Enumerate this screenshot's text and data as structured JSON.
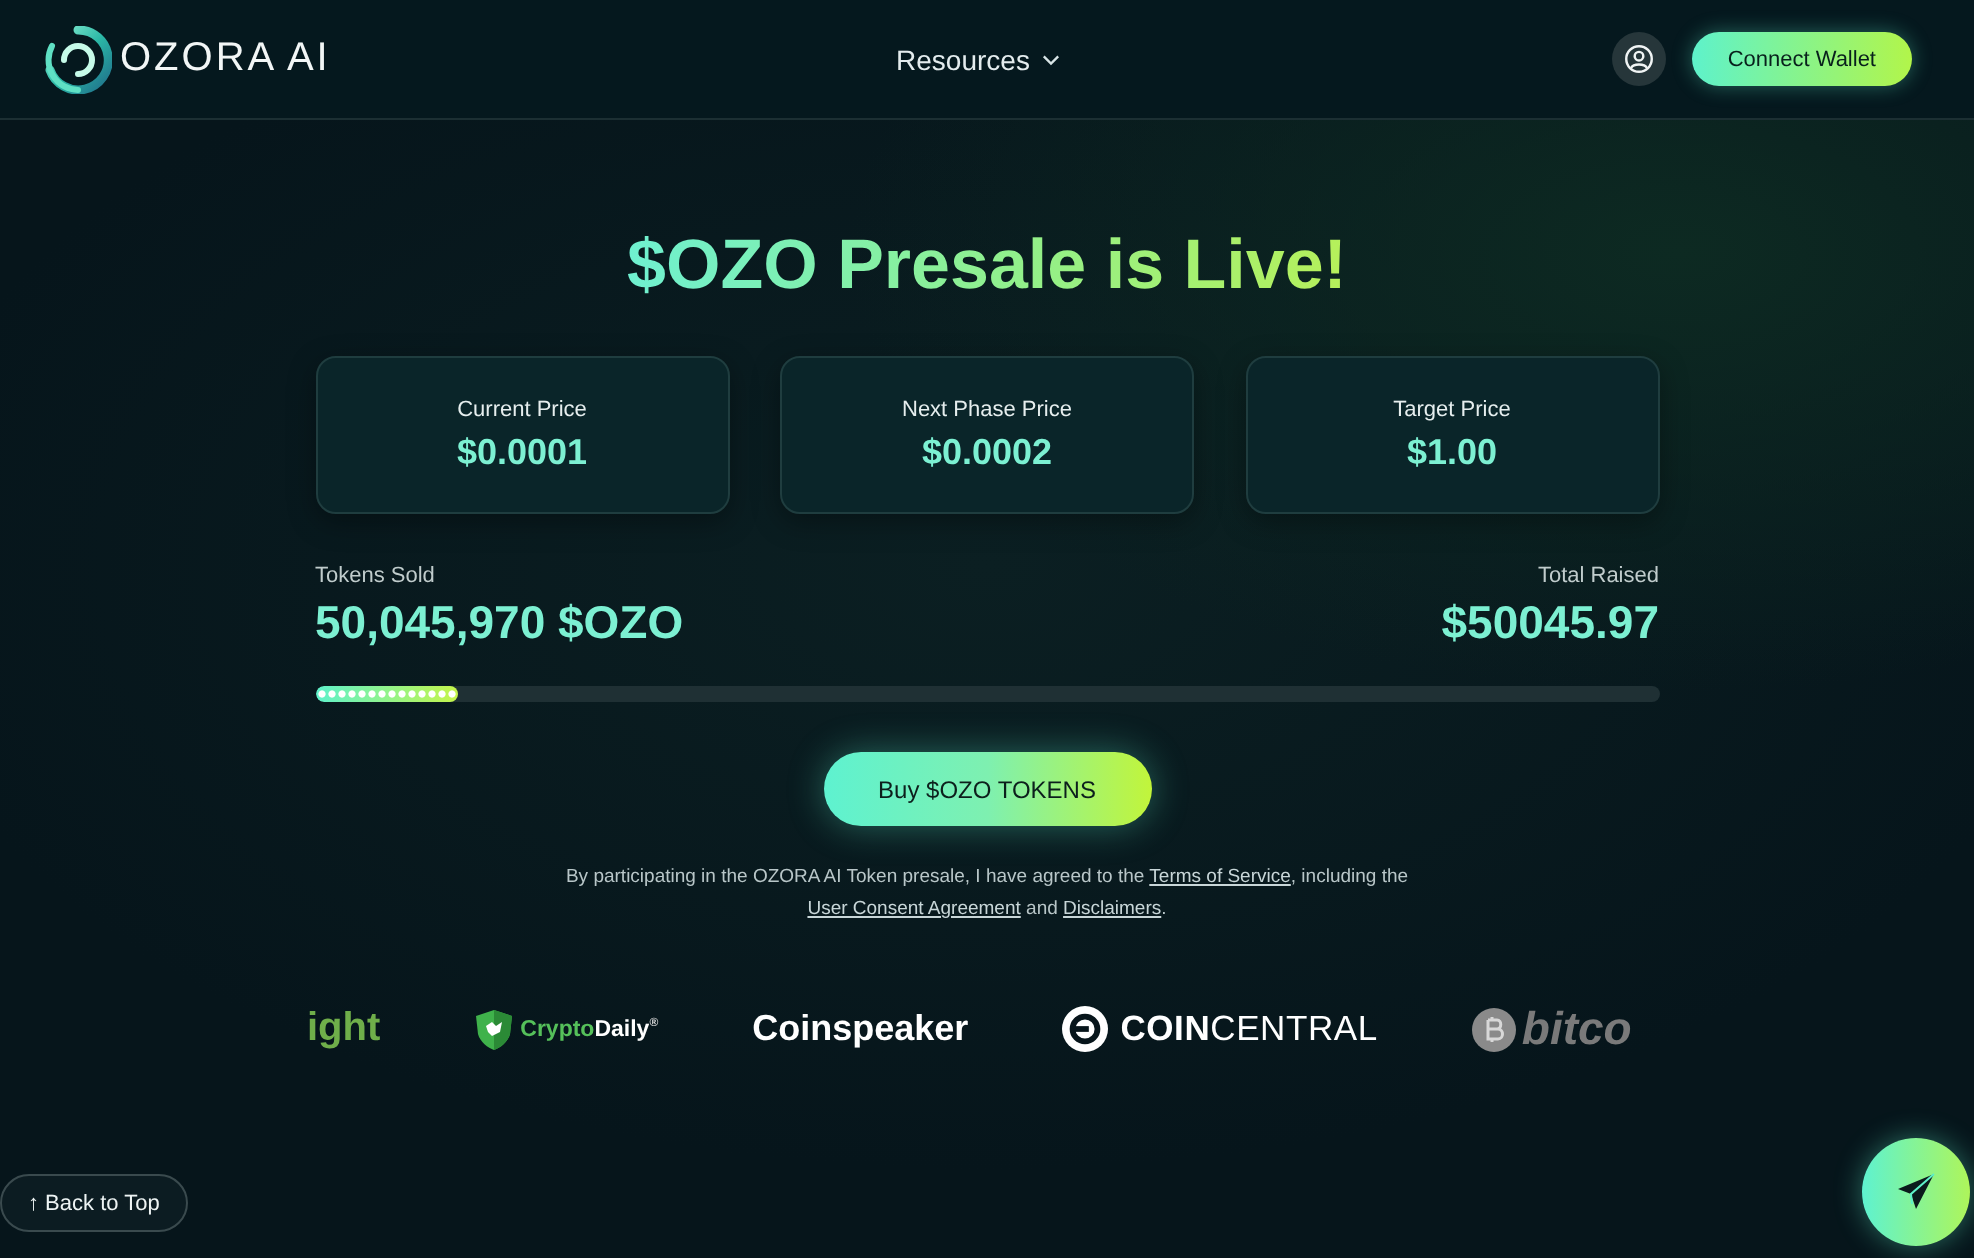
{
  "header": {
    "logo_text": "OZORA AI",
    "nav": [
      {
        "label": "Resources",
        "kind": "dropdown"
      }
    ],
    "connect_button": "Connect Wallet"
  },
  "presale": {
    "title": "$OZO Presale is Live!",
    "prices": [
      {
        "label": "Current Price",
        "value": "$0.0001"
      },
      {
        "label": "Next Phase Price",
        "value": "$0.0002"
      },
      {
        "label": "Target Price",
        "value": "$1.00"
      }
    ],
    "tokens_sold": {
      "label": "Tokens Sold",
      "value": "50,045,970 $OZO"
    },
    "total_raised": {
      "label": "Total Raised",
      "value": "$50045.97"
    },
    "progress": {
      "level": 0.107
    },
    "buy_button": "Buy $OZO TOKENS",
    "legal": [
      {
        "kind": "text",
        "text": "By participating in the OZORA AI Token presale, I have agreed to the "
      },
      {
        "kind": "link",
        "text": "Terms of Service"
      },
      {
        "kind": "text",
        "text": ", including the "
      },
      {
        "kind": "link",
        "text": "User Consent Agreement"
      },
      {
        "kind": "text",
        "text": " and "
      },
      {
        "kind": "link",
        "text": "Disclaimers"
      },
      {
        "kind": "text",
        "text": "."
      }
    ]
  },
  "logos": [
    {
      "kind": "plain",
      "text": "ight"
    },
    {
      "kind": "shield",
      "text": "Crypto",
      "text_2": "Daily",
      "mark": "®"
    },
    {
      "kind": "wordmark",
      "text": "Coinspeaker"
    },
    {
      "kind": "ring",
      "text": "COIN",
      "text_2": "CENTRAL"
    },
    {
      "kind": "coin",
      "text": "bitco"
    }
  ],
  "back_to_top": "↑ Back to Top"
}
